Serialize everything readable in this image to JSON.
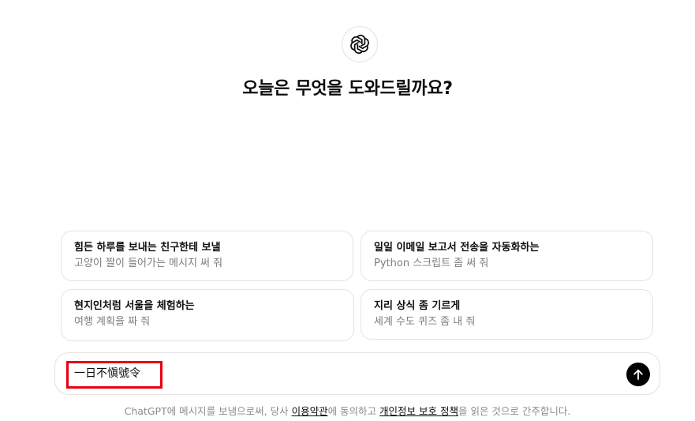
{
  "header": {
    "logo_icon": "openai-logo-icon",
    "headline": "오늘은 무엇을 도와드릴까요?"
  },
  "suggestions": [
    {
      "title": "힘든 하루를 보내는 친구한테 보낼",
      "subtitle": "고양이 짤이 들어가는 메시지 써 줘"
    },
    {
      "title": "일일 이메일 보고서 전송을 자동화하는",
      "subtitle": "Python 스크립트 좀 써 줘"
    },
    {
      "title": "현지인처럼 서울을 체험하는",
      "subtitle": "여행 계획을 짜 줘"
    },
    {
      "title": "지리 상식 좀 기르게",
      "subtitle": "세계 수도 퀴즈 좀 내 줘"
    }
  ],
  "composer": {
    "value": "一日不愼號令",
    "send_icon": "arrow-up-icon",
    "highlight_color": "#e60012"
  },
  "footer": {
    "prefix": "ChatGPT에 메시지를 보냄으로써, 당사 ",
    "terms_link": "이용약관",
    "middle": "에 동의하고 ",
    "privacy_link": "개인정보 보호 정책",
    "suffix": "을 읽은 것으로 간주합니다."
  }
}
